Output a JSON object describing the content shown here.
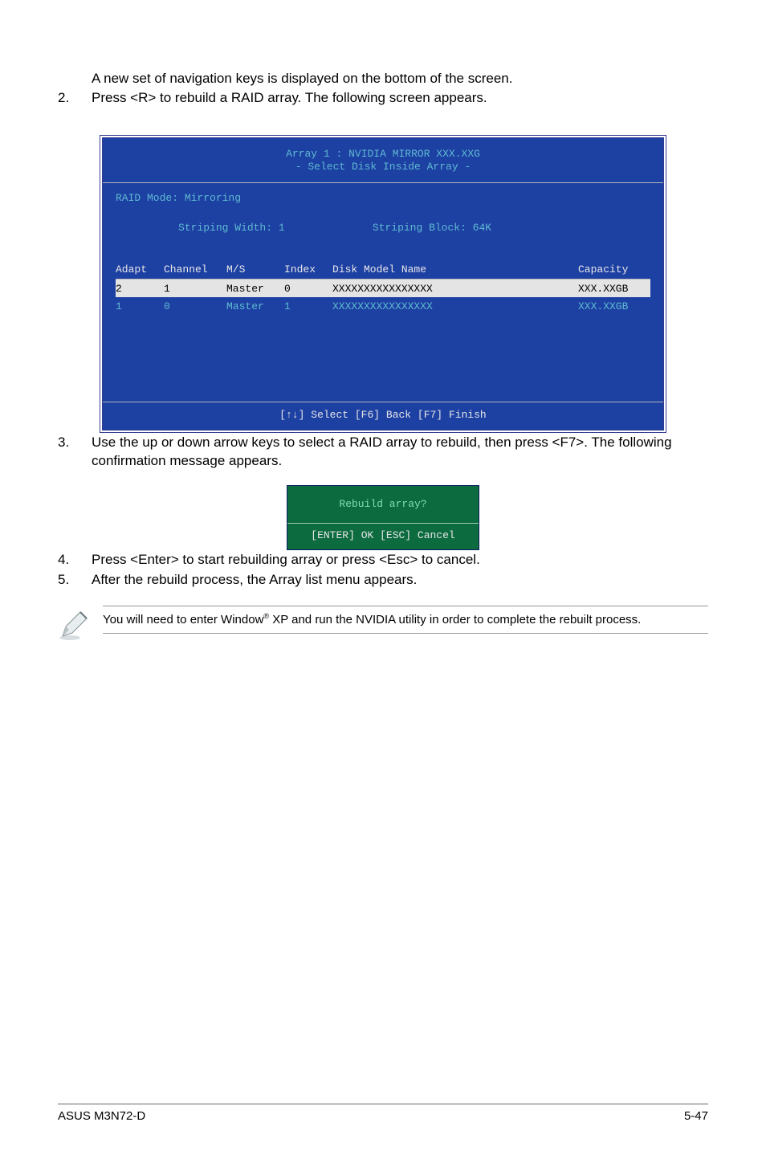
{
  "intro": {
    "line1": "A new set of  navigation keys is displayed on the bottom of the screen.",
    "step2_num": "2.",
    "step2_text": "Press <R> to rebuild a RAID array. The following screen appears."
  },
  "bios": {
    "title_line1": "Array 1 : NVIDIA MIRROR  XXX.XXG",
    "title_line2": "- Select Disk Inside Array -",
    "raid_mode_label": "RAID Mode: Mirroring",
    "striping_width_label": "Striping Width: 1",
    "striping_block_label": "Striping Block: 64K",
    "headers": {
      "adapt": "Adapt",
      "channel": "Channel",
      "ms": "M/S",
      "index": "Index",
      "disk": "Disk Model Name",
      "capacity": "Capacity"
    },
    "rows": [
      {
        "adapt": "2",
        "channel": "1",
        "ms": "Master",
        "index": "0",
        "disk": "XXXXXXXXXXXXXXXX",
        "capacity": "XXX.XXGB",
        "selected": true
      },
      {
        "adapt": "1",
        "channel": "0",
        "ms": "Master",
        "index": "1",
        "disk": "XXXXXXXXXXXXXXXX",
        "capacity": "XXX.XXGB",
        "selected": false
      }
    ],
    "footer": "[↑↓] Select [F6] Back  [F7] Finish"
  },
  "step3": {
    "num": "3.",
    "text": "Use the up or down arrow keys to select a RAID array to rebuild, then press <F7>. The following confirmation message appears."
  },
  "dialog": {
    "question": "Rebuild array?",
    "buttons": "[ENTER] OK  [ESC] Cancel"
  },
  "step4": {
    "num": "4.",
    "text": "Press <Enter> to start rebuilding array or press <Esc> to cancel."
  },
  "step5": {
    "num": "5.",
    "text": "After the rebuild process, the Array list menu appears."
  },
  "note": {
    "prefix": "You will need to enter Window",
    "sup": "®",
    "suffix": " XP and run the NVIDIA utility in order to complete the rebuilt process."
  },
  "footer": {
    "left": "ASUS M3N72-D",
    "right": "5-47"
  }
}
